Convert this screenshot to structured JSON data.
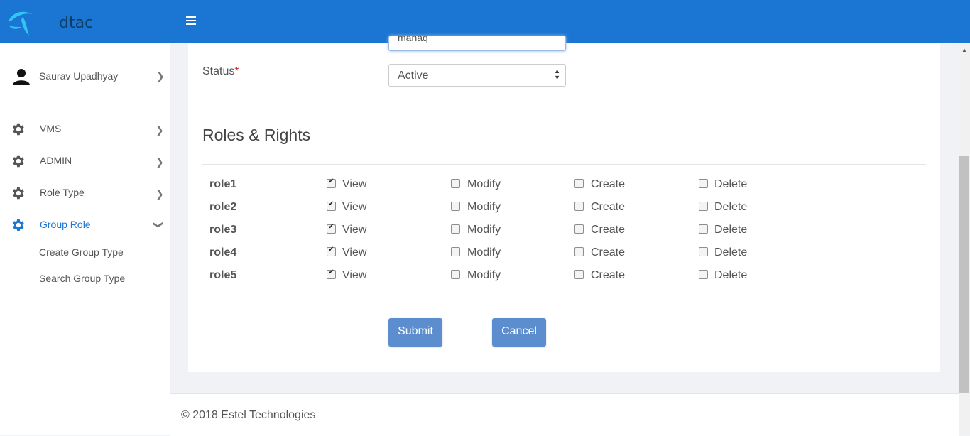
{
  "header": {
    "brand": "dtac"
  },
  "sidebar": {
    "user_name": "Saurav Upadhyay",
    "items": [
      {
        "label": "VMS"
      },
      {
        "label": "ADMIN"
      },
      {
        "label": "Role Type"
      },
      {
        "label": "Group Role"
      }
    ],
    "subitems": [
      {
        "label": "Create Group Type"
      },
      {
        "label": "Search Group Type"
      }
    ]
  },
  "form": {
    "name_value": "manaq",
    "status_label": "Status",
    "required_mark": "*",
    "status_value": "Active",
    "section_title": "Roles & Rights",
    "perm_labels": {
      "view": "View",
      "modify": "Modify",
      "create": "Create",
      "delete": "Delete"
    },
    "roles": [
      {
        "name": "role1",
        "view": true,
        "modify": false,
        "create": false,
        "delete": false
      },
      {
        "name": "role2",
        "view": true,
        "modify": false,
        "create": false,
        "delete": false
      },
      {
        "name": "role3",
        "view": true,
        "modify": false,
        "create": false,
        "delete": false
      },
      {
        "name": "role4",
        "view": true,
        "modify": false,
        "create": false,
        "delete": false
      },
      {
        "name": "role5",
        "view": true,
        "modify": false,
        "create": false,
        "delete": false
      }
    ],
    "submit_label": "Submit",
    "cancel_label": "Cancel"
  },
  "footer": {
    "text": "© 2018 Estel Technologies"
  },
  "colors": {
    "header": "#1a76d2",
    "accent": "#1a76d2",
    "button": "#5b8dcf"
  }
}
